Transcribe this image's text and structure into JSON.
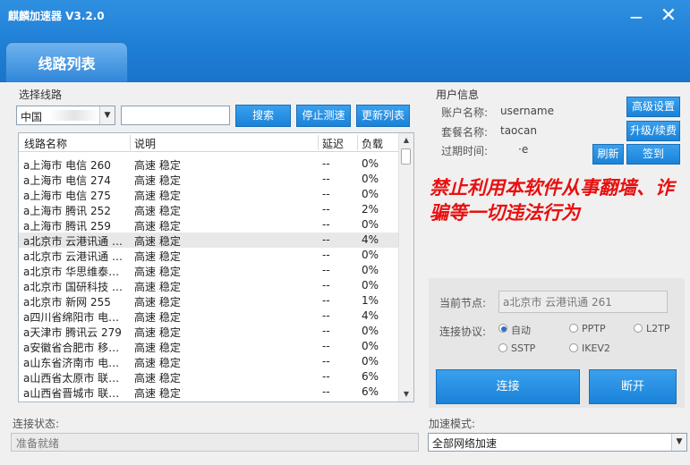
{
  "app": {
    "title": "麒麟加速器 V3.2.0"
  },
  "window": {
    "minimize": "−",
    "close": "✕"
  },
  "tab": {
    "label": "线路列表"
  },
  "line_select": {
    "group_label": "选择线路",
    "region_value": "中国",
    "search_value": "",
    "search_button": "搜索",
    "stop_test_button": "停止测速",
    "update_list_button": "更新列表"
  },
  "table": {
    "columns": [
      "线路名称",
      "说明",
      "延迟",
      "负载"
    ],
    "rows": [
      [
        "a上海市 电信  260",
        "高速 稳定",
        "--",
        "0%"
      ],
      [
        "a上海市 电信  274",
        "高速 稳定",
        "--",
        "0%"
      ],
      [
        "a上海市 电信  275",
        "高速 稳定",
        "--",
        "0%"
      ],
      [
        "a上海市 腾讯  252",
        "高速 稳定",
        "--",
        "2%"
      ],
      [
        "a上海市 腾讯  259",
        "高速 稳定",
        "--",
        "0%"
      ],
      [
        "a北京市 云港讯通  …",
        "高速 稳定",
        "--",
        "4%"
      ],
      [
        "a北京市 云港讯通  …",
        "高速 稳定",
        "--",
        "0%"
      ],
      [
        "a北京市 华思维泰…",
        "高速 稳定",
        "--",
        "0%"
      ],
      [
        "a北京市 国研科技 …",
        "高速 稳定",
        "--",
        "0%"
      ],
      [
        "a北京市 新网  255",
        "高速 稳定",
        "--",
        "1%"
      ],
      [
        "a四川省绵阳市 电…",
        "高速 稳定",
        "--",
        "4%"
      ],
      [
        "a天津市 腾讯云  279",
        "高速 稳定",
        "--",
        "0%"
      ],
      [
        "a安徽省合肥市 移…",
        "高速 稳定",
        "--",
        "0%"
      ],
      [
        "a山东省济南市 电…",
        "高速 稳定",
        "--",
        "0%"
      ],
      [
        "a山西省太原市 联…",
        "高速 稳定",
        "--",
        "6%"
      ],
      [
        "a山西省晋城市 联…",
        "高速 稳定",
        "--",
        "6%"
      ]
    ],
    "selected_index": 5
  },
  "user_info": {
    "group_label": "用户信息",
    "account_label": "账户名称:",
    "account_value": "username",
    "package_label": "套餐名称:",
    "package_value": "taocan",
    "expire_label": "过期时间:",
    "expire_value": "·e",
    "advanced_button": "高级设置",
    "upgrade_button": "升级/续费",
    "refresh_button": "刷新",
    "signin_button": "签到"
  },
  "warning": "禁止利用本软件从事翻墙、诈骗等一切违法行为",
  "connection": {
    "node_label": "当前节点:",
    "node_value": "a北京市 云港讯通  261",
    "protocol_label": "连接协议:",
    "protocols": [
      "自动",
      "PPTP",
      "L2TP",
      "SSTP",
      "IKEV2"
    ],
    "selected_protocol": "自动",
    "connect_button": "连接",
    "disconnect_button": "断开"
  },
  "status": {
    "label": "连接状态:",
    "value": "准备就绪"
  },
  "mode": {
    "label": "加速模式:",
    "value": "全部网络加速"
  },
  "colors": {
    "header": "#1f7fd6",
    "button": "#1a82d8",
    "warning": "#e81010"
  }
}
